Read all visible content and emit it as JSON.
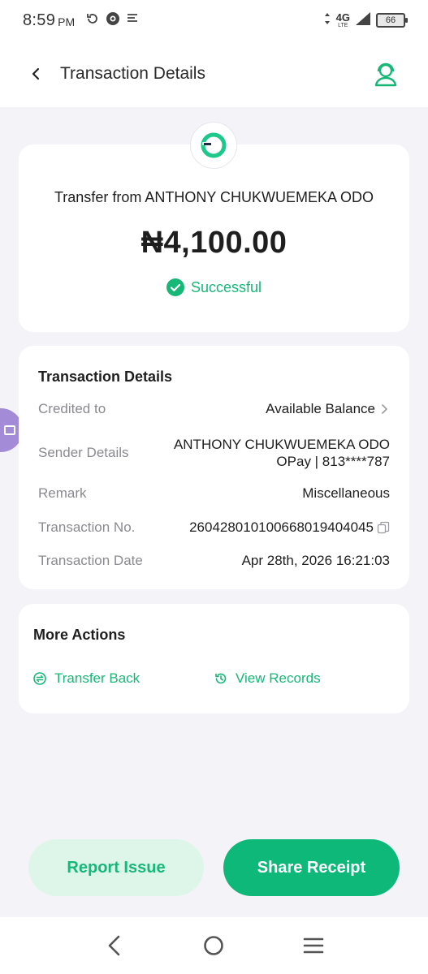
{
  "status_bar": {
    "time": "8:59",
    "ampm": "PM",
    "network": "4G",
    "network_sub": "LTE",
    "battery": "66"
  },
  "header": {
    "title": "Transaction Details",
    "back_icon": "chevron-left-icon",
    "support_icon": "customer-support-icon"
  },
  "summary": {
    "title": "Transfer from ANTHONY CHUKWUEMEKA ODO",
    "amount": "₦4,100.00",
    "status": "Successful"
  },
  "details": {
    "heading": "Transaction Details",
    "credited_to": {
      "label": "Credited to",
      "value": "Available Balance"
    },
    "sender": {
      "label": "Sender Details",
      "name": "ANTHONY CHUKWUEMEKA ODO",
      "account": "OPay | 813****787"
    },
    "remark": {
      "label": "Remark",
      "value": "Miscellaneous"
    },
    "transaction_no": {
      "label": "Transaction No.",
      "value": "260428010100668019404045"
    },
    "transaction_date": {
      "label": "Transaction Date",
      "value": "Apr 28th, 2026 16:21:03"
    }
  },
  "more_actions": {
    "heading": "More Actions",
    "transfer_back": "Transfer Back",
    "view_records": "View Records"
  },
  "buttons": {
    "report_issue": "Report Issue",
    "share_receipt": "Share Receipt"
  },
  "colors": {
    "accent": "#17b877",
    "accent_bg": "#def6ea",
    "primary_button": "#0db878",
    "background": "#f3f3f8",
    "side_tab": "#a48bd8"
  }
}
